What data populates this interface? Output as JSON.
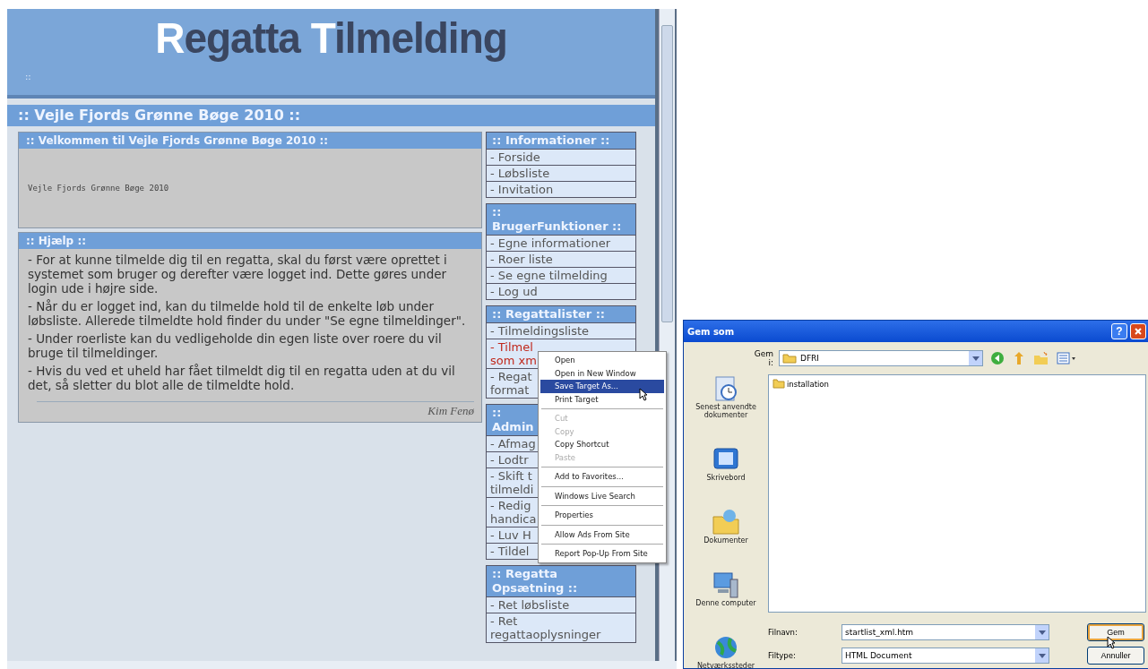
{
  "browser_page": {
    "banner": {
      "title_parts": [
        {
          "text": "R",
          "accent": true
        },
        {
          "text": "egatta ",
          "accent": false
        },
        {
          "text": "T",
          "accent": true
        },
        {
          "text": "ilmelding",
          "accent": false
        }
      ],
      "marker": "::"
    },
    "page_title": ":: Vejle Fjords Grønne Bøge 2010 ::",
    "panels": [
      {
        "kind": "plain",
        "heading": ":: Velkommen til Vejle Fjords Grønne Bøge 2010 ::",
        "paragraphs": [
          "Vejle Fjords Grønne Bøge 2010"
        ]
      },
      {
        "kind": "help",
        "heading": ":: Hjælp ::",
        "paragraphs": [
          "- For at kunne tilmelde dig til en regatta, skal du først være oprettet i systemet som bruger og derefter være logget ind. Dette gøres under login ude i højre side.",
          "- Når du er logget ind, kan du tilmelde hold til de enkelte løb under løbsliste. Allerede tilmeldte hold finder du under \"Se egne tilmeldinger\".",
          "- Under roerliste kan du vedligeholde din egen liste over roere du vil bruge til tilmeldinger.",
          "- Hvis du ved et uheld har fået tilmeldt dig til en regatta uden at du vil det, så sletter du blot alle de tilmeldte hold."
        ],
        "signature": "Kim Fenø"
      }
    ],
    "sidebar": [
      {
        "heading_lines": [
          ":: Informationer ::"
        ],
        "items": [
          {
            "lines": [
              "- Forside"
            ],
            "highlighted": false
          },
          {
            "lines": [
              "- Løbsliste"
            ],
            "highlighted": false
          },
          {
            "lines": [
              "- Invitation"
            ],
            "highlighted": false
          }
        ]
      },
      {
        "heading_lines": [
          "::",
          "BrugerFunktioner ::"
        ],
        "items": [
          {
            "lines": [
              "- Egne informationer"
            ],
            "highlighted": false
          },
          {
            "lines": [
              "- Roer liste"
            ],
            "highlighted": false
          },
          {
            "lines": [
              "- Se egne tilmelding"
            ],
            "highlighted": false
          },
          {
            "lines": [
              "- Log ud"
            ],
            "highlighted": false
          }
        ]
      },
      {
        "heading_lines": [
          ":: Regattalister ::"
        ],
        "items": [
          {
            "lines": [
              "- Tilmeldingsliste"
            ],
            "highlighted": false
          },
          {
            "lines": [
              "- Tilmel",
              "som xm"
            ],
            "highlighted": true
          },
          {
            "lines": [
              "- Regat",
              "format"
            ],
            "highlighted": false
          }
        ]
      },
      {
        "heading_lines": [
          "::",
          "Admin"
        ],
        "items": [
          {
            "lines": [
              "- Afmag"
            ],
            "highlighted": false
          },
          {
            "lines": [
              "- Lodtr"
            ],
            "highlighted": false
          },
          {
            "lines": [
              "- Skift t",
              "tilmeldi"
            ],
            "highlighted": false
          },
          {
            "lines": [
              "- Redig",
              "handica"
            ],
            "highlighted": false
          },
          {
            "lines": [
              "- Luv H"
            ],
            "highlighted": false
          },
          {
            "lines": [
              "- Tildel"
            ],
            "highlighted": false
          }
        ]
      },
      {
        "heading_lines": [
          ":: Regatta",
          "Opsætning ::"
        ],
        "items": [
          {
            "lines": [
              "- Ret løbsliste"
            ],
            "highlighted": false
          },
          {
            "lines": [
              "- Ret",
              "regattaoplysninger"
            ],
            "highlighted": false
          }
        ]
      }
    ]
  },
  "context_menu": {
    "groups": [
      [
        {
          "label": "Open",
          "disabled": false,
          "selected": false
        },
        {
          "label": "Open in New Window",
          "disabled": false,
          "selected": false
        },
        {
          "label": "Save Target As...",
          "disabled": false,
          "selected": true
        },
        {
          "label": "Print Target",
          "disabled": false,
          "selected": false
        }
      ],
      [
        {
          "label": "Cut",
          "disabled": true,
          "selected": false
        },
        {
          "label": "Copy",
          "disabled": true,
          "selected": false
        },
        {
          "label": "Copy Shortcut",
          "disabled": false,
          "selected": false
        },
        {
          "label": "Paste",
          "disabled": true,
          "selected": false
        }
      ],
      [
        {
          "label": "Add to Favorites...",
          "disabled": false,
          "selected": false
        }
      ],
      [
        {
          "label": "Windows Live Search",
          "disabled": false,
          "selected": false
        }
      ],
      [
        {
          "label": "Properties",
          "disabled": false,
          "selected": false
        }
      ],
      [
        {
          "label": "Allow Ads From Site",
          "disabled": false,
          "selected": false
        }
      ],
      [
        {
          "label": "Report Pop-Up From Site",
          "disabled": false,
          "selected": false
        }
      ]
    ]
  },
  "save_dialog": {
    "title": "Gem som",
    "help": "?",
    "location_label": "Gem i:",
    "location": "DFRI",
    "files": [
      {
        "name": "installation"
      }
    ],
    "places": [
      {
        "kind": "recent",
        "label": "Senest anvendte dokumenter"
      },
      {
        "kind": "desktop",
        "label": "Skrivebord"
      },
      {
        "kind": "documents",
        "label": "Dokumenter"
      },
      {
        "kind": "computer",
        "label": "Denne computer"
      },
      {
        "kind": "network",
        "label": "Netværkssteder"
      }
    ],
    "filename_label": "Filnavn:",
    "filename": "startlist_xml.htm",
    "filetype_label": "Filtype:",
    "filetype": "HTML Document",
    "buttons": [
      {
        "label": "Gem",
        "default": true
      },
      {
        "label": "Annuller",
        "default": false
      }
    ]
  }
}
